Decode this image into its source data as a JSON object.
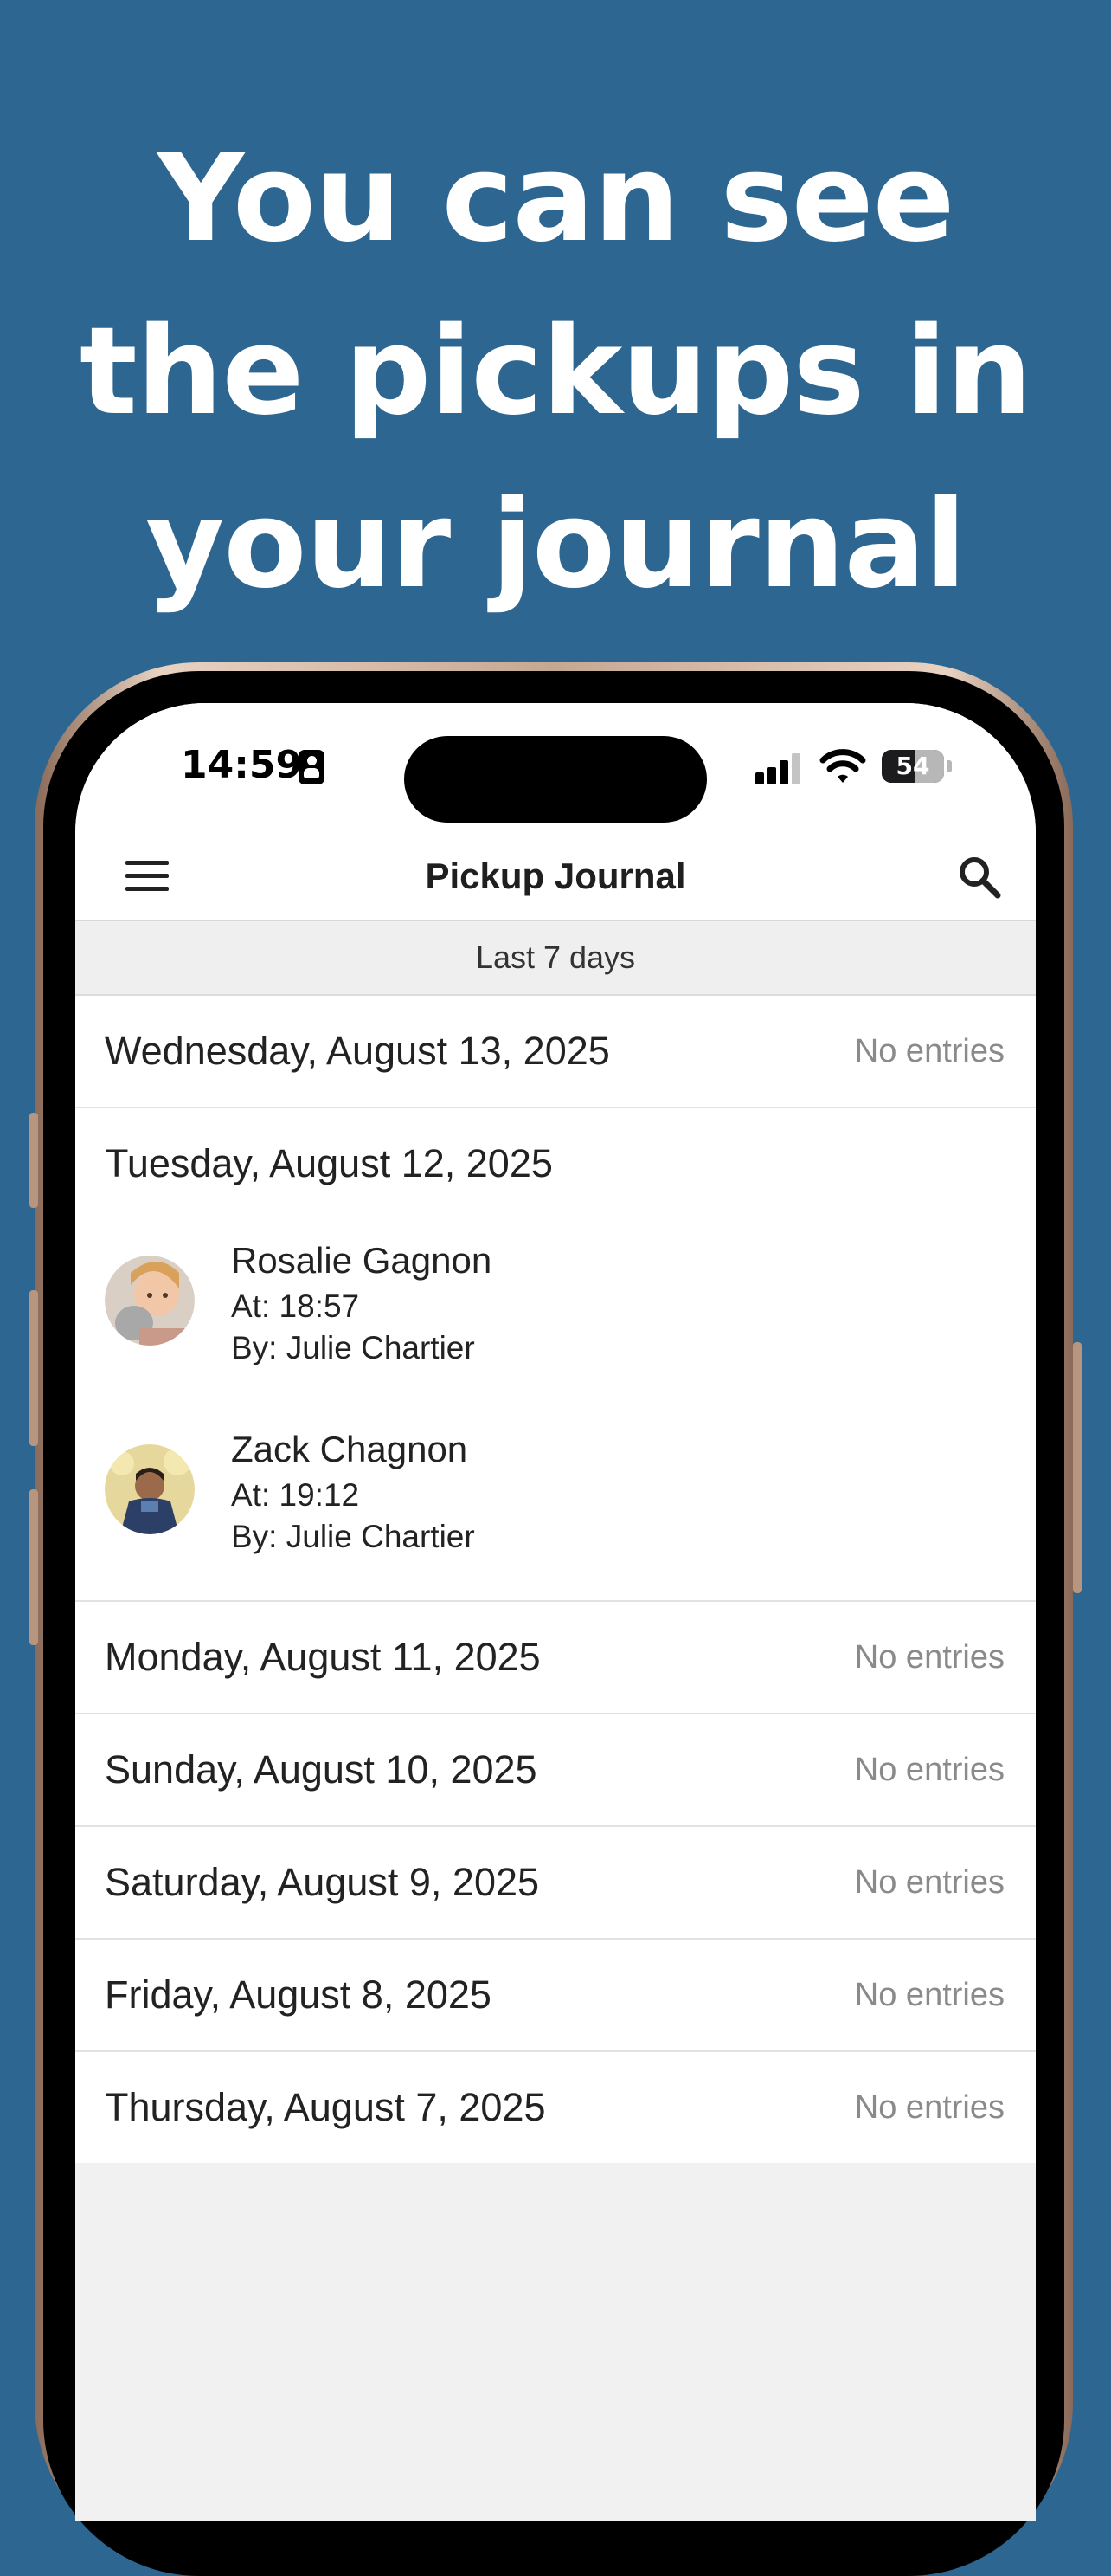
{
  "headline": {
    "line1": "You can see",
    "line2": "the pickups in",
    "line3": "your journal"
  },
  "status_bar": {
    "time": "14:59",
    "battery": "54",
    "battery_level": 0.54
  },
  "navbar": {
    "title": "Pickup Journal"
  },
  "filter": {
    "label": "Last 7 days"
  },
  "days": [
    {
      "date": "Wednesday, August 13, 2025",
      "status": "No entries"
    },
    {
      "date": "Tuesday, August 12, 2025",
      "entries": [
        {
          "name": "Rosalie Gagnon",
          "at": "At: 18:57",
          "by": "By: Julie Chartier"
        },
        {
          "name": "Zack Chagnon",
          "at": "At: 19:12",
          "by": "By: Julie Chartier"
        }
      ]
    },
    {
      "date": "Monday, August 11, 2025",
      "status": "No entries"
    },
    {
      "date": "Sunday, August 10, 2025",
      "status": "No entries"
    },
    {
      "date": "Saturday, August 9, 2025",
      "status": "No entries"
    },
    {
      "date": "Friday, August 8, 2025",
      "status": "No entries"
    },
    {
      "date": "Thursday, August 7, 2025",
      "status": "No entries"
    }
  ],
  "colors": {
    "background": "#2d6690",
    "screen_bg": "#f1f1f1",
    "empty_text": "#8a8a8a"
  },
  "icons": {
    "menu": "hamburger-menu-icon",
    "search": "search-icon",
    "signal": "cellular-signal-icon",
    "wifi": "wifi-icon",
    "battery": "battery-icon",
    "contact": "contact-card-icon"
  }
}
